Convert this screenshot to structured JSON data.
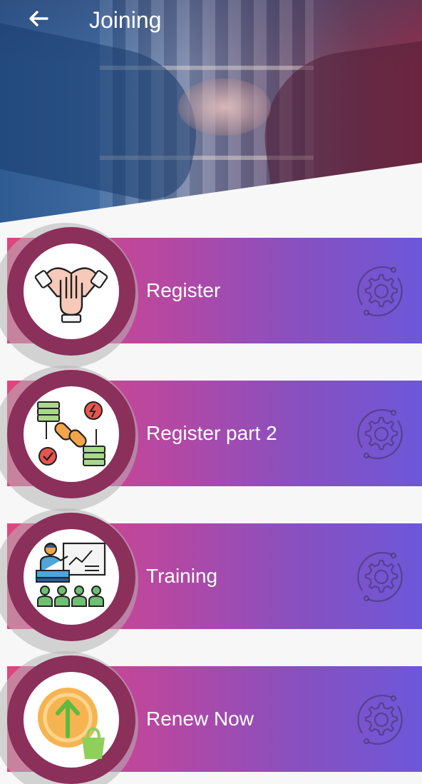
{
  "header": {
    "title": "Joining",
    "back_icon": "arrow-left-icon"
  },
  "menu": [
    {
      "label": "Register",
      "icon": "handshake-icon",
      "action_icon": "gear-icon"
    },
    {
      "label": "Register part 2",
      "icon": "data-link-icon",
      "action_icon": "gear-icon"
    },
    {
      "label": "Training",
      "icon": "training-presentation-icon",
      "action_icon": "gear-icon"
    },
    {
      "label": "Renew Now",
      "icon": "renew-upload-icon",
      "action_icon": "gear-icon"
    }
  ],
  "colors": {
    "card_gradient_start": "#e1457f",
    "card_gradient_end": "#6d57d9",
    "badge_ring": "#8b2f5b",
    "background": "#f7f7f7"
  }
}
